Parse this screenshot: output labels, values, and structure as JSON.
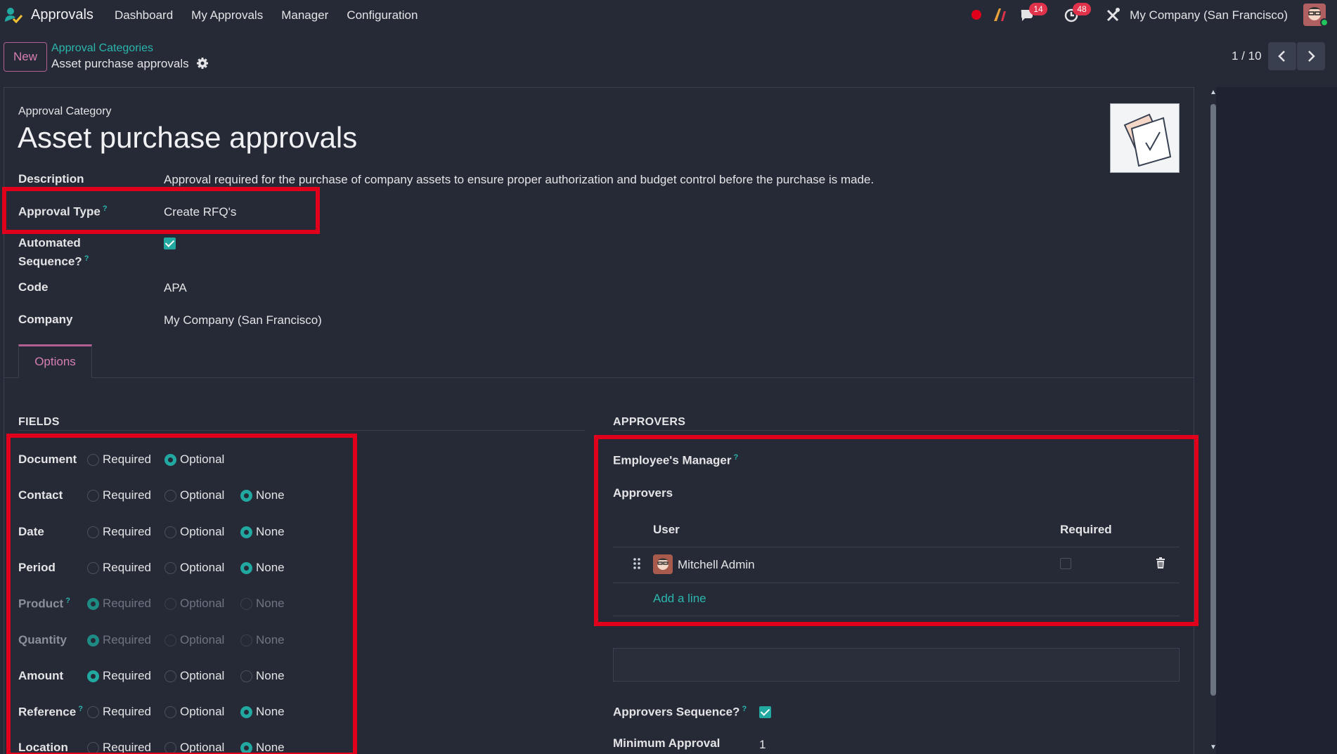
{
  "navbar": {
    "app_name": "Approvals",
    "menu": [
      "Dashboard",
      "My Approvals",
      "Manager",
      "Configuration"
    ],
    "messages_badge": "14",
    "activities_badge": "48",
    "company": "My Company (San Francisco)"
  },
  "control_panel": {
    "new_label": "New",
    "breadcrumb_parent": "Approval Categories",
    "breadcrumb_current": "Asset purchase approvals",
    "pager": "1 / 10"
  },
  "form": {
    "overline": "Approval Category",
    "title": "Asset purchase approvals",
    "description_label": "Description",
    "description_value": "Approval required for the purchase of company assets to ensure proper authorization and budget control before the purchase is made.",
    "approval_type_label": "Approval Type",
    "approval_type_value": "Create RFQ's",
    "automated_sequence_label_1": "Automated",
    "automated_sequence_label_2": "Sequence?",
    "automated_sequence_checked": true,
    "code_label": "Code",
    "code_value": "APA",
    "company_label": "Company",
    "company_value": "My Company (San Francisco)",
    "help_marker": "?"
  },
  "tabs": {
    "options": "Options"
  },
  "fields_section": {
    "title": "FIELDS",
    "option_labels": {
      "required": "Required",
      "optional": "Optional",
      "none": "None"
    },
    "rows": [
      {
        "label": "Document",
        "selected": "optional",
        "has_none": false,
        "disabled": false,
        "help": false
      },
      {
        "label": "Contact",
        "selected": "none",
        "has_none": true,
        "disabled": false,
        "help": false
      },
      {
        "label": "Date",
        "selected": "none",
        "has_none": true,
        "disabled": false,
        "help": false
      },
      {
        "label": "Period",
        "selected": "none",
        "has_none": true,
        "disabled": false,
        "help": false
      },
      {
        "label": "Product",
        "selected": "required",
        "has_none": true,
        "disabled": true,
        "help": true
      },
      {
        "label": "Quantity",
        "selected": "required",
        "has_none": true,
        "disabled": true,
        "help": false
      },
      {
        "label": "Amount",
        "selected": "required",
        "has_none": true,
        "disabled": false,
        "help": false
      },
      {
        "label": "Reference",
        "selected": "none",
        "has_none": true,
        "disabled": false,
        "help": true
      },
      {
        "label": "Location",
        "selected": "none",
        "has_none": true,
        "disabled": false,
        "help": false
      }
    ]
  },
  "approvers_section": {
    "title": "APPROVERS",
    "employees_manager_label": "Employee's Manager",
    "approvers_label": "Approvers",
    "col_user": "User",
    "col_required": "Required",
    "rows": [
      {
        "user": "Mitchell Admin",
        "required": false
      }
    ],
    "add_line": "Add a line",
    "approvers_sequence_label": "Approvers Sequence?",
    "approvers_sequence_checked": true,
    "minimum_approval_label": "Minimum Approval",
    "minimum_approval_value": "1"
  },
  "colors": {
    "background": "#262a36",
    "accent_teal": "#21a8a0",
    "accent_pink": "#b25f93",
    "highlight_red": "#e0001b",
    "badge_red": "#e0324a"
  }
}
